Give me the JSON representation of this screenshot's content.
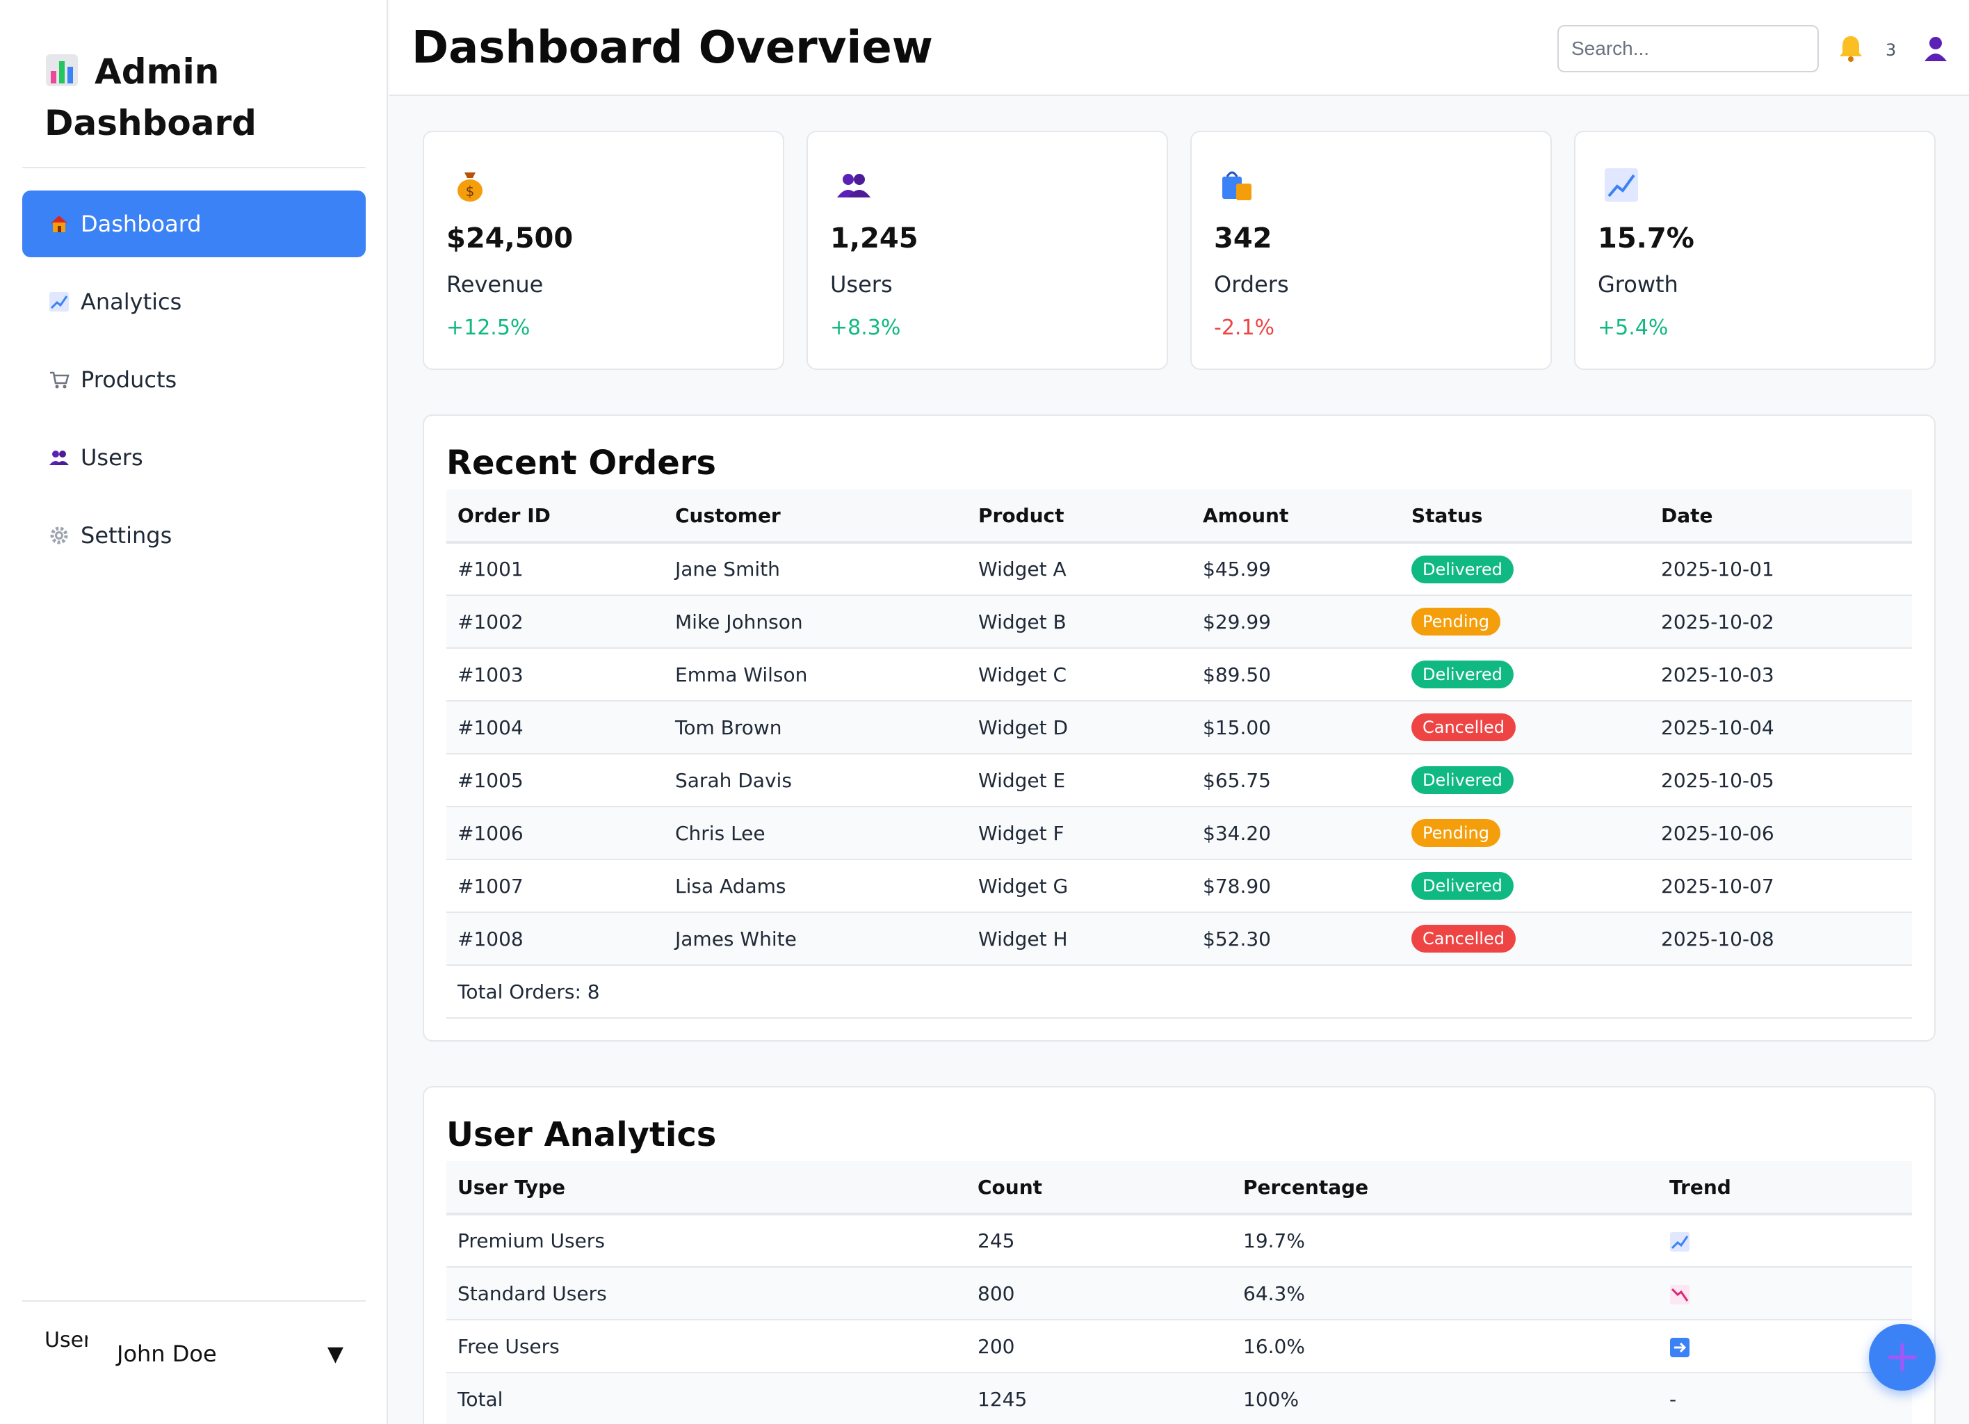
{
  "sidebar": {
    "brand_icon": "bar-chart-icon",
    "brand_line1": "Admin",
    "brand_line2": "Dashboard",
    "items": [
      {
        "label": "Dashboard",
        "icon": "house-icon",
        "active": true
      },
      {
        "label": "Analytics",
        "icon": "chart-up-icon",
        "active": false
      },
      {
        "label": "Products",
        "icon": "cart-icon",
        "active": false
      },
      {
        "label": "Users",
        "icon": "users-icon",
        "active": false
      },
      {
        "label": "Settings",
        "icon": "gear-icon",
        "active": false
      }
    ],
    "user": {
      "avatar_alt": "User",
      "name": "John Doe",
      "caret": "▼"
    }
  },
  "header": {
    "title": "Dashboard Overview",
    "search_placeholder": "Search...",
    "notification_count": "3"
  },
  "stats": [
    {
      "icon": "money-bag-icon",
      "value": "$24,500",
      "label": "Revenue",
      "change": "+12.5%",
      "direction": "up"
    },
    {
      "icon": "users-icon",
      "value": "1,245",
      "label": "Users",
      "change": "+8.3%",
      "direction": "up"
    },
    {
      "icon": "shopping-bags-icon",
      "value": "342",
      "label": "Orders",
      "change": "-2.1%",
      "direction": "down"
    },
    {
      "icon": "chart-up-icon",
      "value": "15.7%",
      "label": "Growth",
      "change": "+5.4%",
      "direction": "up"
    }
  ],
  "orders": {
    "title": "Recent Orders",
    "columns": [
      "Order ID",
      "Customer",
      "Product",
      "Amount",
      "Status",
      "Date"
    ],
    "rows": [
      {
        "id": "#1001",
        "customer": "Jane Smith",
        "product": "Widget A",
        "amount": "$45.99",
        "status": "Delivered",
        "date": "2025-10-01"
      },
      {
        "id": "#1002",
        "customer": "Mike Johnson",
        "product": "Widget B",
        "amount": "$29.99",
        "status": "Pending",
        "date": "2025-10-02"
      },
      {
        "id": "#1003",
        "customer": "Emma Wilson",
        "product": "Widget C",
        "amount": "$89.50",
        "status": "Delivered",
        "date": "2025-10-03"
      },
      {
        "id": "#1004",
        "customer": "Tom Brown",
        "product": "Widget D",
        "amount": "$15.00",
        "status": "Cancelled",
        "date": "2025-10-04"
      },
      {
        "id": "#1005",
        "customer": "Sarah Davis",
        "product": "Widget E",
        "amount": "$65.75",
        "status": "Delivered",
        "date": "2025-10-05"
      },
      {
        "id": "#1006",
        "customer": "Chris Lee",
        "product": "Widget F",
        "amount": "$34.20",
        "status": "Pending",
        "date": "2025-10-06"
      },
      {
        "id": "#1007",
        "customer": "Lisa Adams",
        "product": "Widget G",
        "amount": "$78.90",
        "status": "Delivered",
        "date": "2025-10-07"
      },
      {
        "id": "#1008",
        "customer": "James White",
        "product": "Widget H",
        "amount": "$52.30",
        "status": "Cancelled",
        "date": "2025-10-08"
      }
    ],
    "footer": "Total Orders: 8"
  },
  "analytics": {
    "title": "User Analytics",
    "columns": [
      "User Type",
      "Count",
      "Percentage",
      "Trend"
    ],
    "rows": [
      {
        "type": "Premium Users",
        "count": "245",
        "percentage": "19.7%",
        "trend": "chart-up-icon"
      },
      {
        "type": "Standard Users",
        "count": "800",
        "percentage": "64.3%",
        "trend": "chart-down-icon"
      },
      {
        "type": "Free Users",
        "count": "200",
        "percentage": "16.0%",
        "trend": "arrow-right-icon"
      },
      {
        "type": "Total",
        "count": "1245",
        "percentage": "100%",
        "trend": "-"
      }
    ]
  },
  "colors": {
    "accent": "#3b82f6",
    "positive": "#10b981",
    "negative": "#ef4444",
    "pending": "#f59e0b"
  }
}
